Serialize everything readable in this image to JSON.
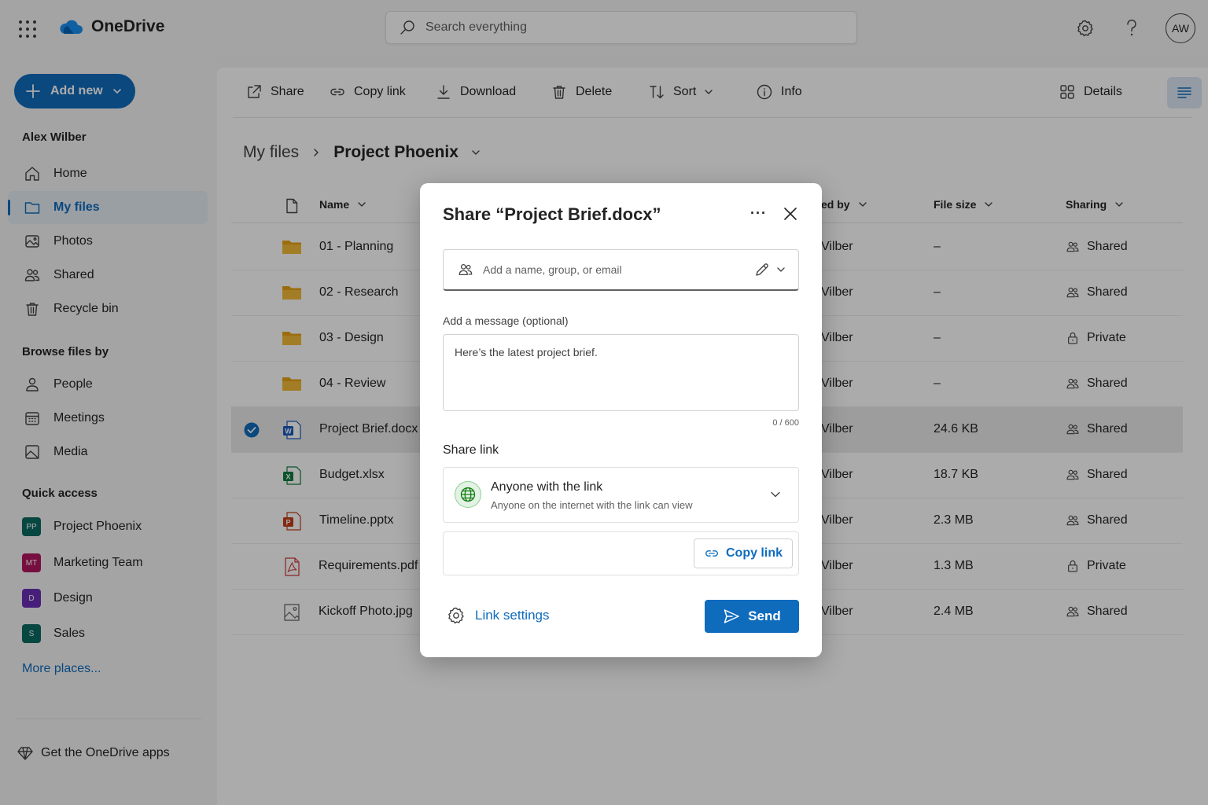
{
  "app": {
    "name": "OneDrive"
  },
  "search": {
    "placeholder": "Search everything"
  },
  "user": {
    "initials": "AW",
    "name": "Alex Wilber"
  },
  "sidebar": {
    "add_new_label": "Add new",
    "nav": [
      {
        "label": "Home",
        "icon": "home-icon"
      },
      {
        "label": "My files",
        "icon": "folder-icon",
        "active": true
      },
      {
        "label": "Photos",
        "icon": "photo-icon"
      },
      {
        "label": "Shared",
        "icon": "people-icon"
      },
      {
        "label": "Recycle bin",
        "icon": "trash-icon"
      }
    ],
    "browse_heading": "Browse files by",
    "browse": [
      {
        "label": "People",
        "icon": "person-icon"
      },
      {
        "label": "Meetings",
        "icon": "calendar-icon"
      },
      {
        "label": "Media",
        "icon": "image-icon"
      }
    ],
    "quick_access_heading": "Quick access",
    "quick_access": [
      {
        "badge": "PP",
        "label": "Project Phoenix",
        "color": "#0b6a62"
      },
      {
        "badge": "MT",
        "label": "Marketing Team",
        "color": "#b0175f"
      },
      {
        "badge": "D",
        "label": "Design",
        "color": "#6b2fb8"
      },
      {
        "badge": "S",
        "label": "Sales",
        "color": "#0b6a62"
      }
    ],
    "more_places": "More places...",
    "get_apps": "Get the OneDrive apps"
  },
  "commandbar": {
    "share": "Share",
    "copy_link": "Copy link",
    "download": "Download",
    "delete": "Delete",
    "sort": "Sort",
    "info": "Info",
    "details": "Details"
  },
  "breadcrumb": {
    "root": "My files",
    "current": "Project Phoenix"
  },
  "table": {
    "headers": {
      "name": "Name",
      "modified_by": "ed by",
      "file_size": "File size",
      "sharing": "Sharing"
    },
    "rows": [
      {
        "name": "01 - Planning",
        "type": "folder",
        "modified_by": "Vilber",
        "size": "–",
        "sharing": "Shared"
      },
      {
        "name": "02 - Research",
        "type": "folder",
        "modified_by": "Vilber",
        "size": "–",
        "sharing": "Shared"
      },
      {
        "name": "03 - Design",
        "type": "folder",
        "modified_by": "Vilber",
        "size": "–",
        "sharing": "Private"
      },
      {
        "name": "04 - Review",
        "type": "folder",
        "modified_by": "Vilber",
        "size": "–",
        "sharing": "Shared"
      },
      {
        "name": "Project Brief.docx",
        "type": "word",
        "modified_by": "Vilber",
        "size": "24.6 KB",
        "sharing": "Shared",
        "selected": true
      },
      {
        "name": "Budget.xlsx",
        "type": "excel",
        "modified_by": "Vilber",
        "size": "18.7 KB",
        "sharing": "Shared"
      },
      {
        "name": "Timeline.pptx",
        "type": "powerpoint",
        "modified_by": "Vilber",
        "size": "2.3 MB",
        "sharing": "Shared"
      },
      {
        "name": "Requirements.pdf",
        "type": "pdf",
        "modified_by": "Vilber",
        "size": "1.3 MB",
        "sharing": "Private"
      },
      {
        "name": "Kickoff Photo.jpg",
        "type": "image",
        "modified_by": "Vilber",
        "size": "2.4 MB",
        "sharing": "Shared"
      }
    ]
  },
  "dialog": {
    "title": "Share “Project Brief.docx”",
    "more": "···",
    "people_placeholder": "Add a name, group, or email",
    "message_label": "Add a message (optional)",
    "message_value": "Here’s the latest project brief.",
    "message_count": "0 / 600",
    "share_link_label": "Share link",
    "scope_title": "Anyone with the link",
    "scope_subtitle": "Anyone on the internet with the link can view",
    "copy_link": "Copy link",
    "link_settings": "Link settings",
    "send": "Send"
  },
  "colors": {
    "accent": "#0f6cbd",
    "folder": "#e8a317",
    "word": "#185abd",
    "excel": "#107c41",
    "powerpoint": "#c43e1c",
    "pdf": "#d13438",
    "globe": "#107c10"
  }
}
